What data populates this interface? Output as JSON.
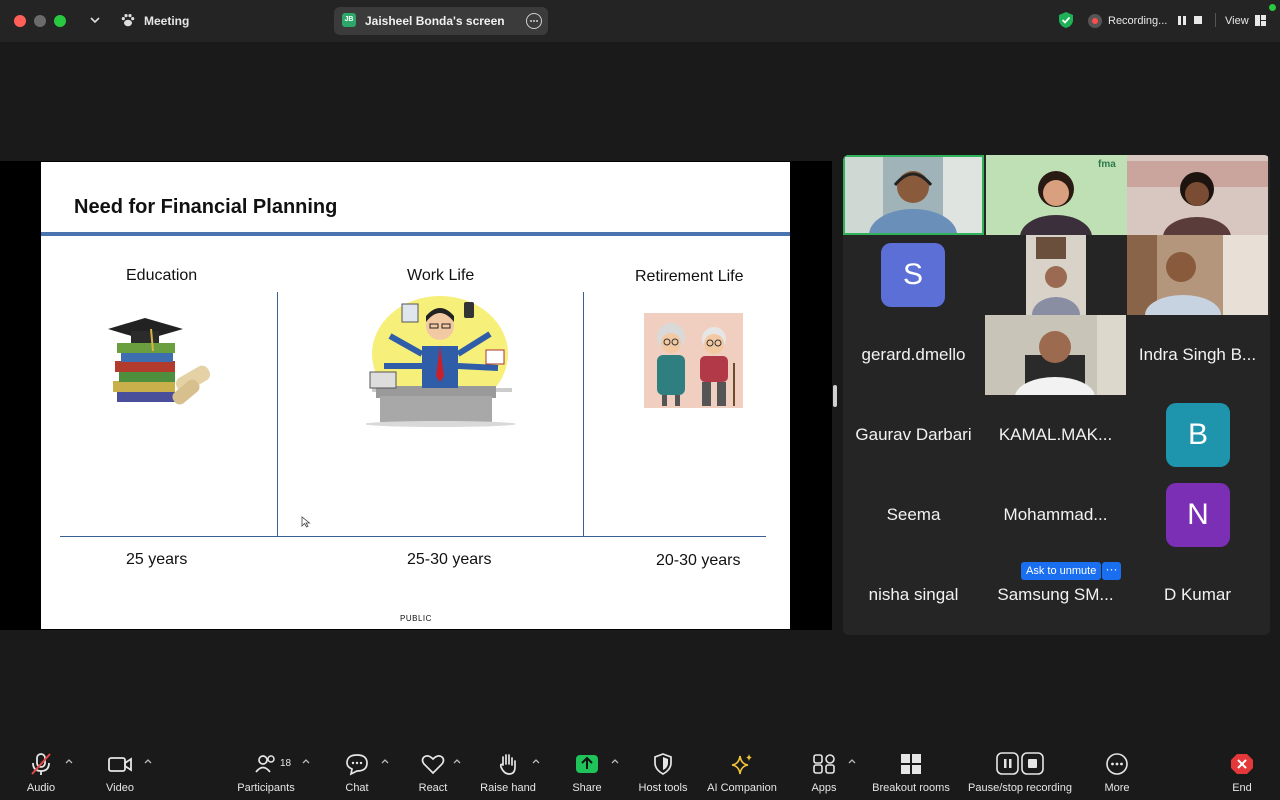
{
  "window": {
    "meeting_title": "Meeting",
    "shared_screen": "Jaisheel Bonda's screen",
    "shared_initials": "JB",
    "recording_label": "Recording...",
    "view_label": "View"
  },
  "slide": {
    "title": "Need for Financial Planning",
    "columns": [
      {
        "heading": "Education",
        "years": "25 years"
      },
      {
        "heading": "Work Life",
        "years": "25-30 years"
      },
      {
        "heading": "Retirement Life",
        "years": "20-30 years"
      }
    ],
    "footer": "PUBLIC"
  },
  "gallery": {
    "names": {
      "gerard": "gerard.dmello",
      "indra": "Indra Singh B...",
      "gaurav": "Gaurav Darbari",
      "kamal": "KAMAL.MAK...",
      "seema": "Seema",
      "mohammad": "Mohammad...",
      "nisha": "nisha singal",
      "samsung": "Samsung SM...",
      "dkumar": "D Kumar"
    },
    "avatars": {
      "s": {
        "letter": "S",
        "color": "#5b6fd6"
      },
      "b": {
        "letter": "B",
        "color": "#1e95ad"
      },
      "n": {
        "letter": "N",
        "color": "#7b2fb5"
      }
    },
    "fma_logo": "fma",
    "ask_to_unmute": "Ask to unmute",
    "more": "···"
  },
  "toolbar": {
    "audio": "Audio",
    "video": "Video",
    "participants": "Participants",
    "participants_count": "18",
    "chat": "Chat",
    "react": "React",
    "raise_hand": "Raise hand",
    "share": "Share",
    "host_tools": "Host tools",
    "ai_companion": "AI Companion",
    "apps": "Apps",
    "breakout_rooms": "Breakout rooms",
    "pause_stop_recording": "Pause/stop recording",
    "more": "More",
    "end": "End"
  }
}
